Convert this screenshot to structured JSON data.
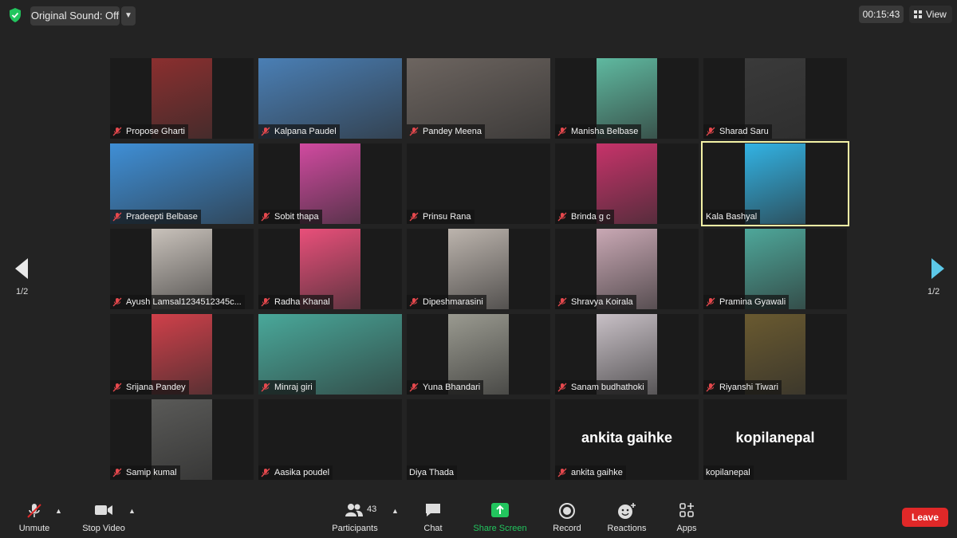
{
  "top_bar": {
    "original_sound_label": "Original Sound: Off",
    "timer": "00:15:43",
    "view_label": "View"
  },
  "pager": {
    "left_label": "1/2",
    "right_label": "1/2"
  },
  "participants": [
    {
      "name": "Propose Gharti",
      "muted": true
    },
    {
      "name": "Kalpana Paudel",
      "muted": true
    },
    {
      "name": "Pandey Meena",
      "muted": true
    },
    {
      "name": "Manisha Belbase",
      "muted": true
    },
    {
      "name": "Sharad Saru",
      "muted": true
    },
    {
      "name": "Pradeepti Belbase",
      "muted": true
    },
    {
      "name": "Sobit thapa",
      "muted": true
    },
    {
      "name": "Prinsu Rana",
      "muted": true
    },
    {
      "name": "Brinda g c",
      "muted": true
    },
    {
      "name": "Kala Bashyal",
      "muted": false
    },
    {
      "name": "Ayush Lamsal1234512345c...",
      "muted": true
    },
    {
      "name": "Radha Khanal",
      "muted": true
    },
    {
      "name": "Dipeshmarasini",
      "muted": true
    },
    {
      "name": "Shravya Koirala",
      "muted": true
    },
    {
      "name": "Pramina Gyawali",
      "muted": true
    },
    {
      "name": "Srijana Pandey",
      "muted": true
    },
    {
      "name": "Minraj giri",
      "muted": true
    },
    {
      "name": "Yuna  Bhandari",
      "muted": true
    },
    {
      "name": "Sanam budhathoki",
      "muted": true
    },
    {
      "name": "Riyanshi Tiwari",
      "muted": true
    },
    {
      "name": "Samip kumal",
      "muted": true
    },
    {
      "name": "Aasika poudel",
      "muted": true
    },
    {
      "name": "Diya Thada",
      "muted": false
    },
    {
      "name": "ankita  gaihke",
      "muted": true,
      "big_name": "ankita  gaihke"
    },
    {
      "name": "kopilanepal",
      "muted": false,
      "big_name": "kopilanepal"
    }
  ],
  "video_colors": [
    "#8b2f2f",
    "#4a7fb5",
    "#6d6560",
    "#5fb9a0",
    "#3a3a3a",
    "#3f8fd6",
    "#d14aa0",
    "",
    "#c7336a",
    "#32b3e4",
    "#c9c2bb",
    "#e94f7a",
    "#bcb4ad",
    "#c9a8b4",
    "#4ea79a",
    "#d0404a",
    "#49a89a",
    "#9a9a90",
    "#c8c0c6",
    "#6a5a30",
    "#5a5a58",
    "",
    "",
    "",
    ""
  ],
  "toolbar": {
    "unmute": "Unmute",
    "stop_video": "Stop Video",
    "participants": "Participants",
    "participant_count": "43",
    "chat": "Chat",
    "share_screen": "Share Screen",
    "record": "Record",
    "reactions": "Reactions",
    "apps": "Apps",
    "leave": "Leave"
  },
  "colors": {
    "share_green": "#22c55e",
    "leave_red": "#e02828",
    "active_speaker": "#f3f1a5"
  }
}
